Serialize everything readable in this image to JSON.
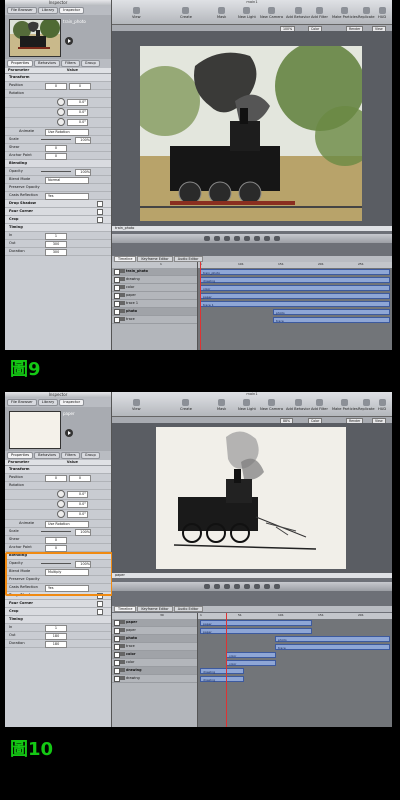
{
  "screens": [
    {
      "app_title": "Inspector",
      "main_title": "main1",
      "left_tabs": [
        "File Browser",
        "Library",
        "Inspector"
      ],
      "inspector_tabs": [
        "Properties",
        "Behaviors",
        "Filters",
        "Group"
      ],
      "selected_layer": "train_photo",
      "parameter_header": "Parameter",
      "value_header": "Value",
      "rows": {
        "transform": "Transform",
        "position": "Position",
        "position_x": "0",
        "position_y": "0",
        "rotation": "Rotation",
        "rot_x": "0.0°",
        "rot_y": "0.0°",
        "rot_z": "0.0°",
        "animate": "Animate",
        "animate_val": "Use Rotation",
        "scale": "Scale",
        "scale_val": "100%",
        "shear": "Shear",
        "shear_val": "0",
        "anchor": "Anchor Point",
        "anchor_val": "0",
        "blending": "Blending",
        "opacity": "Opacity",
        "opacity_val": "100%",
        "blend_mode": "Blend Mode",
        "blend_mode_val": "Normal",
        "preserve_opacity": "Preserve Opacity",
        "casts_reflection": "Casts Reflection",
        "casts_reflection_val": "Yes",
        "drop_shadow": "Drop Shadow",
        "four_corner": "Four Corner",
        "crop": "Crop",
        "timing": "Timing",
        "in": "In",
        "in_val": "1",
        "out": "Out",
        "out_val": "300",
        "duration": "Duration",
        "duration_val": "300"
      },
      "toolbar": [
        "View",
        "Create",
        "Mask",
        "New Light",
        "New Camera",
        "Add Behavior",
        "Add Filter",
        "Make Particles",
        "Replicate",
        "HUD"
      ],
      "sub": {
        "zoom": "100%",
        "color": "Color",
        "render": "Render",
        "view": "View"
      },
      "transport_label": "train_photo",
      "timeline_tabs": [
        "Timeline",
        "Keyframe Editor",
        "Audio Editor"
      ],
      "frame": "1",
      "ruler": [
        "1",
        "101",
        "151",
        "201",
        "251"
      ],
      "layers": [
        {
          "name": "train_photo",
          "group": true
        },
        {
          "name": "drawing",
          "group": false
        },
        {
          "name": "color",
          "group": false
        },
        {
          "name": "paper",
          "group": false
        },
        {
          "name": "trace 1",
          "group": false
        },
        {
          "name": "photo",
          "group": true
        },
        {
          "name": "trace",
          "group": false
        }
      ],
      "bars": [
        "train_photo",
        "drawing",
        "color",
        "paper",
        "trace 1",
        "photo",
        "trace"
      ],
      "caption": "圖9"
    },
    {
      "app_title": "Inspector",
      "main_title": "main1",
      "left_tabs": [
        "File Browser",
        "Library",
        "Inspector"
      ],
      "inspector_tabs": [
        "Properties",
        "Behaviors",
        "Filters",
        "Group"
      ],
      "selected_layer": "paper",
      "parameter_header": "Parameter",
      "value_header": "Value",
      "rows": {
        "transform": "Transform",
        "position": "Position",
        "position_x": "0",
        "position_y": "0",
        "rotation": "Rotation",
        "rot_x": "0.0°",
        "rot_y": "0.0°",
        "rot_z": "0.0°",
        "animate": "Animate",
        "animate_val": "Use Rotation",
        "scale": "Scale",
        "scale_val": "100%",
        "shear": "Shear",
        "shear_val": "0",
        "anchor": "Anchor Point",
        "anchor_val": "0",
        "blending": "Blending",
        "opacity": "Opacity",
        "opacity_val": "100%",
        "blend_mode": "Blend Mode",
        "blend_mode_val": "Multiply",
        "preserve_opacity": "Preserve Opacity",
        "casts_reflection": "Casts Reflection",
        "casts_reflection_val": "Yes",
        "drop_shadow": "Drop Shadow",
        "four_corner": "Four Corner",
        "crop": "Crop",
        "timing": "Timing",
        "in": "In",
        "in_val": "1",
        "out": "Out",
        "out_val": "180",
        "duration": "Duration",
        "duration_val": "180"
      },
      "toolbar": [
        "View",
        "Create",
        "Mask",
        "New Light",
        "New Camera",
        "Add Behavior",
        "Add Filter",
        "Make Particles",
        "Replicate",
        "HUD"
      ],
      "sub": {
        "zoom": "88%",
        "color": "Color",
        "render": "Render",
        "view": "View"
      },
      "transport_label": "paper",
      "timeline_tabs": [
        "Timeline",
        "Keyframe Editor",
        "Audio Editor"
      ],
      "frame": "30",
      "ruler": [
        "1",
        "51",
        "101",
        "151",
        "201"
      ],
      "layers": [
        {
          "name": "paper",
          "group": true
        },
        {
          "name": "paper",
          "group": false
        },
        {
          "name": "photo",
          "group": true
        },
        {
          "name": "trace",
          "group": false
        },
        {
          "name": "color",
          "group": true
        },
        {
          "name": "color",
          "group": false
        },
        {
          "name": "drawing",
          "group": true
        },
        {
          "name": "drawing",
          "group": false
        }
      ],
      "bars": [
        "paper",
        "paper",
        "photo",
        "trace",
        "color",
        "color",
        "drawing",
        "drawing"
      ],
      "caption": "圖10"
    }
  ]
}
